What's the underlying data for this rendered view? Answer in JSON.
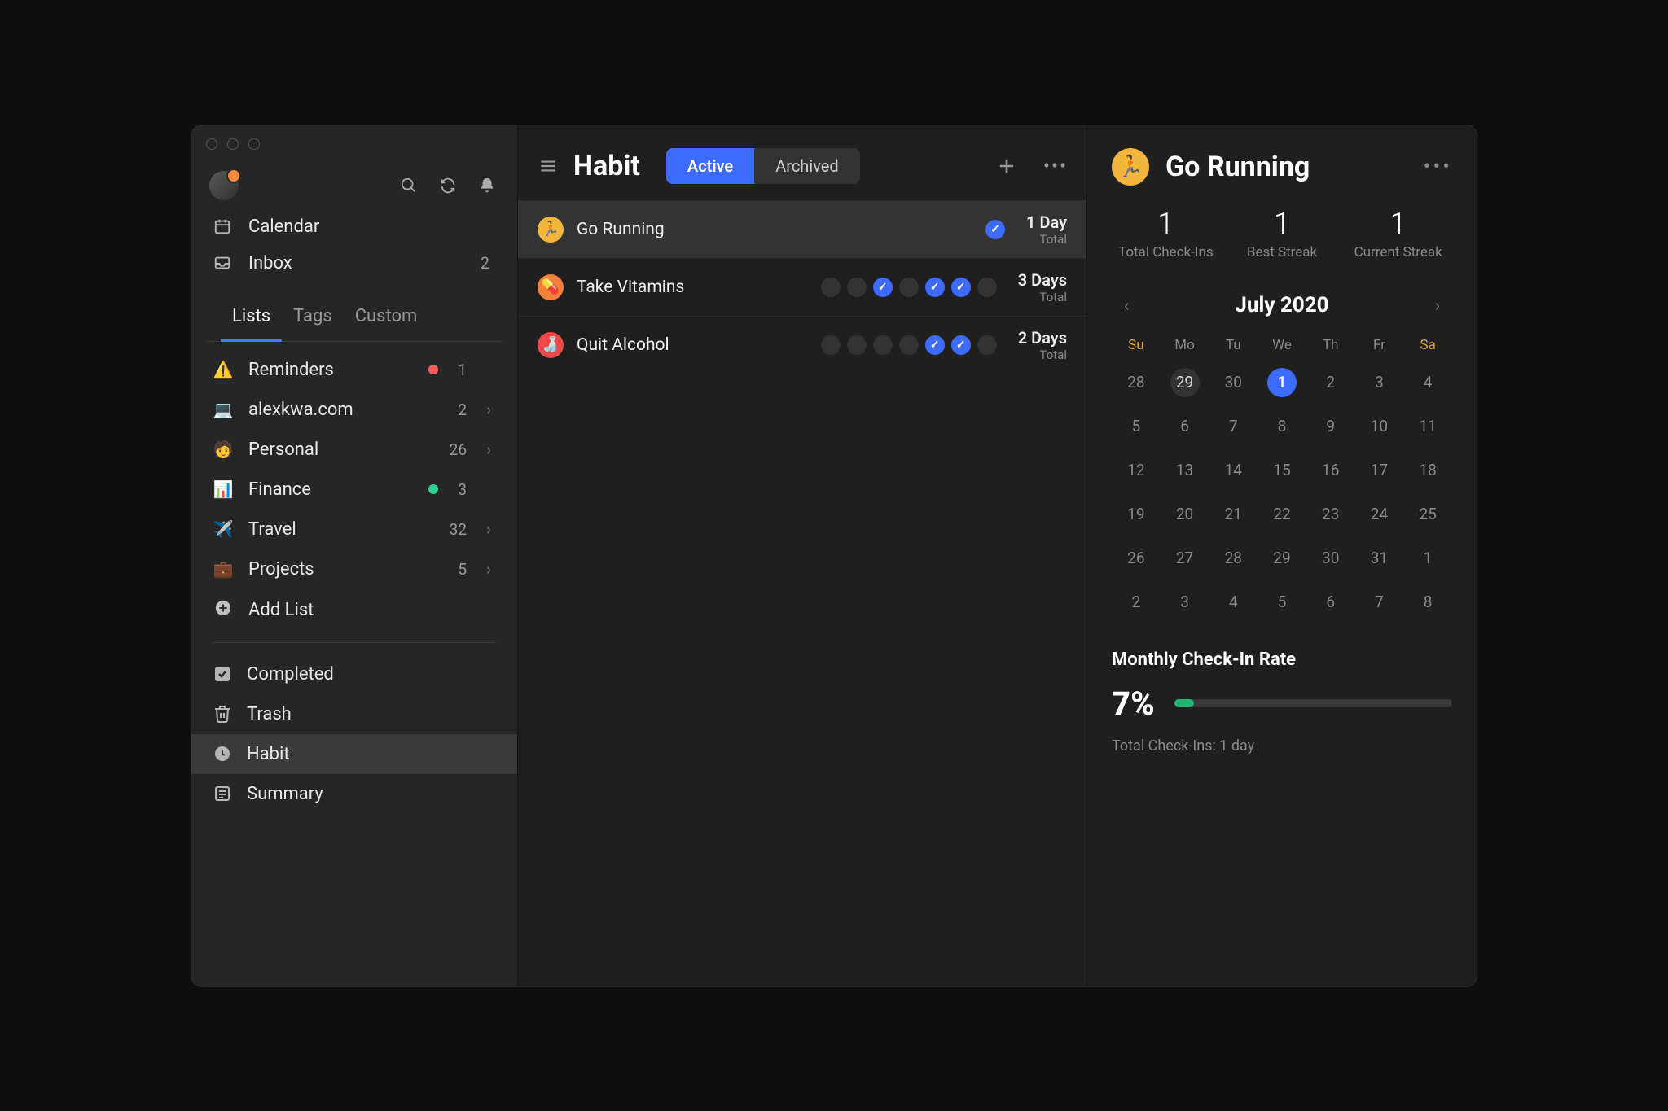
{
  "sidebar": {
    "nav": {
      "calendar": "Calendar",
      "inbox": "Inbox",
      "inbox_count": "2"
    },
    "tabs": [
      "Lists",
      "Tags",
      "Custom"
    ],
    "active_tab": 0,
    "lists": [
      {
        "emoji": "⚠️",
        "label": "Reminders",
        "count": "1",
        "dot": "#ff5b5b",
        "chevron": false
      },
      {
        "emoji": "💻",
        "label": "alexkwa.com",
        "count": "2",
        "chevron": true
      },
      {
        "emoji": "🧑",
        "label": "Personal",
        "count": "26",
        "chevron": true
      },
      {
        "emoji": "📊",
        "label": "Finance",
        "count": "3",
        "dot": "#2fcf91",
        "chevron": false
      },
      {
        "emoji": "✈️",
        "label": "Travel",
        "count": "32",
        "chevron": true
      },
      {
        "emoji": "💼",
        "label": "Projects",
        "count": "5",
        "chevron": true
      }
    ],
    "add_list": "Add List",
    "system": [
      {
        "key": "completed",
        "label": "Completed"
      },
      {
        "key": "trash",
        "label": "Trash"
      },
      {
        "key": "habit",
        "label": "Habit",
        "selected": true
      },
      {
        "key": "summary",
        "label": "Summary"
      }
    ]
  },
  "middle": {
    "title": "Habit",
    "seg": {
      "active": "Active",
      "archived": "Archived"
    },
    "habits": [
      {
        "name": "Go Running",
        "color": "#f2b63c",
        "emoji": "🏃",
        "pattern": [
          0,
          0,
          0,
          0,
          0,
          0,
          1
        ],
        "streak": "1 Day",
        "sub": "Total",
        "selected": true
      },
      {
        "name": "Take Vitamins",
        "color": "#f27f3c",
        "emoji": "💊",
        "pattern": [
          0,
          0,
          1,
          0,
          1,
          1,
          0
        ],
        "streak": "3 Days",
        "sub": "Total"
      },
      {
        "name": "Quit Alcohol",
        "color": "#f04848",
        "emoji": "🍶",
        "pattern": [
          0,
          0,
          0,
          0,
          1,
          1,
          0
        ],
        "streak": "2 Days",
        "sub": "Total"
      }
    ]
  },
  "right": {
    "title": "Go Running",
    "badge_emoji": "🏃",
    "stats": [
      {
        "num": "1",
        "label": "Total Check-Ins"
      },
      {
        "num": "1",
        "label": "Best Streak"
      },
      {
        "num": "1",
        "label": "Current Streak"
      }
    ],
    "calendar": {
      "month": "July 2020",
      "dow": [
        "Su",
        "Mo",
        "Tu",
        "We",
        "Th",
        "Fr",
        "Sa"
      ],
      "days": [
        [
          28,
          29,
          30,
          1,
          2,
          3,
          4
        ],
        [
          5,
          6,
          7,
          8,
          9,
          10,
          11
        ],
        [
          12,
          13,
          14,
          15,
          16,
          17,
          18
        ],
        [
          19,
          20,
          21,
          22,
          23,
          24,
          25
        ],
        [
          26,
          27,
          28,
          29,
          30,
          31,
          1
        ],
        [
          2,
          3,
          4,
          5,
          6,
          7,
          8
        ]
      ],
      "today": 1,
      "hover": 29,
      "today_row": 0,
      "hover_row": 0
    },
    "rate": {
      "title": "Monthly Check-In Rate",
      "pct_text": "7%",
      "pct_value": 7,
      "sub": "Total Check-Ins: 1 day"
    }
  }
}
